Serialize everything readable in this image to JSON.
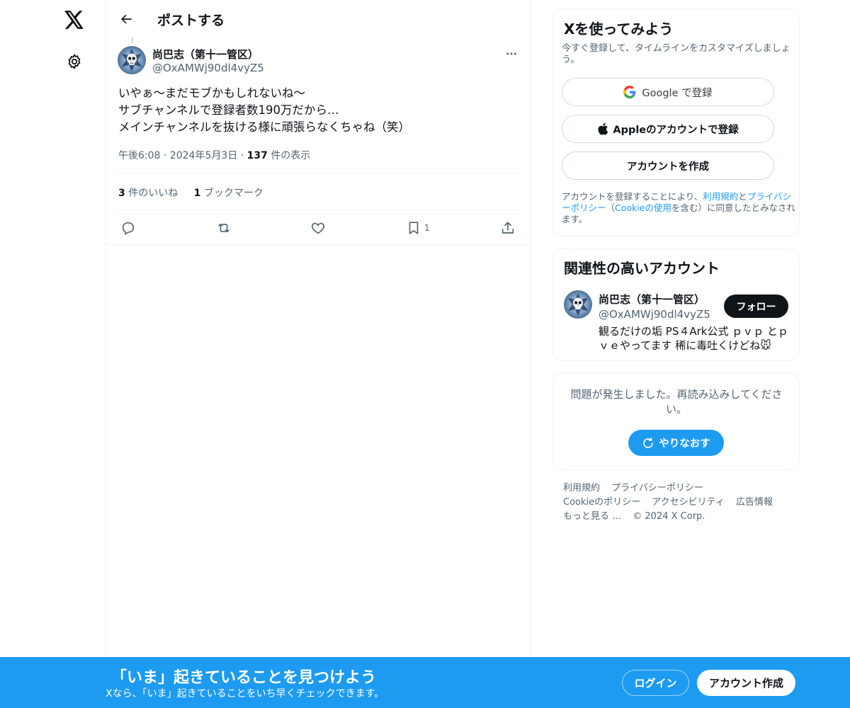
{
  "nav": {
    "logo_icon": "x-logo-icon",
    "settings_icon": "gear-icon"
  },
  "header": {
    "title": "ポストする",
    "back_icon": "arrow-left-icon"
  },
  "post": {
    "author_name": "尚巴志（第十一管区）",
    "author_handle": "@OxAMWj90dl4vyZ5",
    "text_lines": [
      "いやぁ〜まだモブかもしれないね〜",
      "サブチャンネルで登録者数190万だから…",
      "メインチャンネルを抜ける様に頑張らなくちゃね（笑）"
    ],
    "time": "午後6:08",
    "date": "2024年5月3日",
    "views_count": "137",
    "views_label": "件の表示",
    "likes_count": "3",
    "likes_label": "件のいいね",
    "bookmarks_count": "1",
    "bookmarks_label": "ブックマーク",
    "bookmark_action_count": "1"
  },
  "signup_card": {
    "title": "Xを使ってみよう",
    "subtitle": "今すぐ登録して、タイムラインをカスタマイズしましょう。",
    "google_label": "Google で登録",
    "apple_label": "Appleのアカウントで登録",
    "create_label": "アカウントを作成",
    "legal_prefix": "アカウントを登録することにより、",
    "terms_link": "利用規約",
    "legal_and": "と",
    "privacy_link": "プライバシーポリシー",
    "legal_paren_open": "（",
    "cookie_link": "Cookieの使用",
    "legal_suffix": "を含む）に同意したとみなされます。"
  },
  "related": {
    "title": "関連性の高いアカウント",
    "name": "尚巴志（第十一管区）",
    "handle": "@OxAMWj90dl4vyZ5",
    "follow_label": "フォロー",
    "bio": "観るだけの垢 PS４Ark公式 ｐｖｐ とｐｖｅやってます 稀に毒吐くけどね🐭"
  },
  "error_card": {
    "message": "問題が発生しました。再読み込みしてください。",
    "retry_label": "やりなおす"
  },
  "footer": {
    "terms": "利用規約",
    "privacy": "プライバシーポリシー",
    "cookie": "Cookieのポリシー",
    "accessibility": "アクセシビリティ",
    "ads": "広告情報",
    "more": "もっと見る …",
    "copyright": "© 2024 X Corp."
  },
  "bottom_bar": {
    "title": "「いま」起きていることを見つけよう",
    "subtitle": "Xなら、「いま」起きていることをいち早くチェックできます。",
    "login_label": "ログイン",
    "signup_label": "アカウント作成"
  },
  "colors": {
    "accent": "#1d9bf0",
    "text": "#0f1419",
    "secondary": "#536471",
    "border": "#eff3f4"
  }
}
